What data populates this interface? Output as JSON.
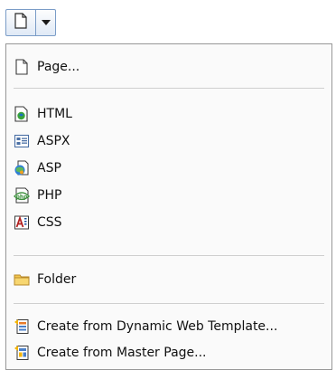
{
  "new_button": {
    "main_icon": "new-page-icon",
    "arrow_icon": "chevron-down-icon"
  },
  "menu": {
    "items": [
      {
        "label": "Page...",
        "icon": "page-icon"
      },
      {
        "label": "HTML",
        "icon": "html-icon"
      },
      {
        "label": "ASPX",
        "icon": "aspx-icon"
      },
      {
        "label": "ASP",
        "icon": "asp-icon"
      },
      {
        "label": "PHP",
        "icon": "php-icon"
      },
      {
        "label": "CSS",
        "icon": "css-icon"
      },
      {
        "label": "Folder",
        "icon": "folder-icon"
      },
      {
        "label": "Create from Dynamic Web Template...",
        "icon": "dynamic-web-template-icon"
      },
      {
        "label": "Create from Master Page...",
        "icon": "master-page-icon"
      }
    ]
  }
}
